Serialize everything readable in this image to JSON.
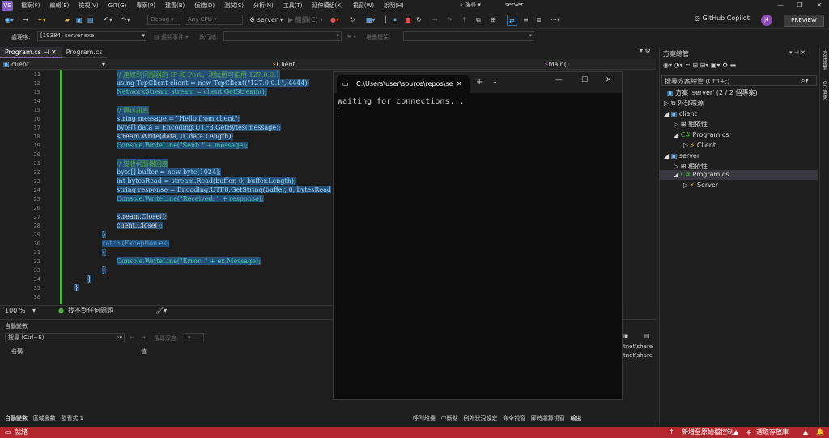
{
  "menu": {
    "items": [
      "檔案(F)",
      "編輯(E)",
      "檢視(V)",
      "GIT(G)",
      "專案(P)",
      "建置(B)",
      "偵錯(D)",
      "測試(S)",
      "分析(N)",
      "工具(T)",
      "延伸模組(X)",
      "視窗(W)",
      "說明(H)"
    ],
    "search": "搜尋",
    "solution": "server"
  },
  "toolbar": {
    "config": "Debug",
    "platform": "Any CPU",
    "startup": "server",
    "continue": "繼續(C)",
    "copilot": "GitHub Copilot",
    "preview": "PREVIEW",
    "avatar": "J4"
  },
  "toolbar2": {
    "process_label": "處理序:",
    "process": "[19384] server.exe",
    "event": "週期事件",
    "thread": "執行緒:",
    "stack": "堆疊框架:"
  },
  "tabs": [
    {
      "label": "Program.cs"
    },
    {
      "label": "Program.cs"
    }
  ],
  "navbar": {
    "project": "client",
    "class": "Client",
    "member": "Main()"
  },
  "editor": {
    "line_numbers": [
      "11",
      "12",
      "13",
      "14",
      "15",
      "16",
      "17",
      "18",
      "19",
      "20",
      "21",
      "22",
      "23",
      "24",
      "25",
      "26",
      "27",
      "28",
      "29",
      "30",
      "31",
      "32",
      "33",
      "34",
      "35",
      "36"
    ],
    "lines": [
      "// 連線到伺服器的 IP 和 Port，測試用可能用 127.0.0.1",
      "using TcpClient client = new TcpClient(\"127.0.0.1\", 4444);",
      "NetworkStream stream = client.GetStream();",
      "",
      "// 傳送訊息",
      "string message = \"Hello from client\";",
      "byte[] data = Encoding.UTF8.GetBytes(message);",
      "stream.Write(data, 0, data.Length);",
      "Console.WriteLine(\"Sent: \" + message);",
      "",
      "// 接收伺服器回應",
      "byte[] buffer = new byte[1024];",
      "int bytesRead = stream.Read(buffer, 0, buffer.Length);",
      "string response = Encoding.UTF8.GetString(buffer, 0, bytesRead",
      "Console.WriteLine(\"Received: \" + response);",
      "",
      "stream.Close();",
      "client.Close();",
      "}",
      "catch (Exception ex)",
      "{",
      "Console.WriteLine(\"Error: \" + ex.Message);",
      "}",
      "}",
      "}",
      ""
    ]
  },
  "status": {
    "zoom": "100 %",
    "issues": "找不到任何問題"
  },
  "autos": {
    "title": "自動變數",
    "search": "搜尋 (Ctrl+E)",
    "depth": "搜尋深度:",
    "col_name": "名稱",
    "col_value": "值",
    "out1": "tnet\\share",
    "out2": "tnet\\share"
  },
  "bottom_tabs": {
    "left": [
      "自動變數",
      "區域變數",
      "監看式 1"
    ],
    "right": [
      "呼叫堆疊",
      "中斷點",
      "例外狀況設定",
      "命令視窗",
      "即時運算視窗",
      "輸出"
    ]
  },
  "solution_explorer": {
    "title": "方案總管",
    "search": "搜尋方案總管 (Ctrl+;)",
    "items": [
      "方案 'server' (2 / 2 個專案)",
      "外部來源",
      "client",
      "相依性",
      "Program.cs",
      "Client",
      "server",
      "相依性",
      "Program.cs",
      "Server"
    ]
  },
  "rail": {
    "a": "方案總管",
    "b": "Git 變更"
  },
  "console": {
    "tab": "C:\\Users\\user\\source\\repos\\se",
    "text": "Waiting for connections..."
  },
  "redbar": {
    "ready": "就緒",
    "source_control": "新增至原始檔控制",
    "repo": "選取存放庫"
  }
}
